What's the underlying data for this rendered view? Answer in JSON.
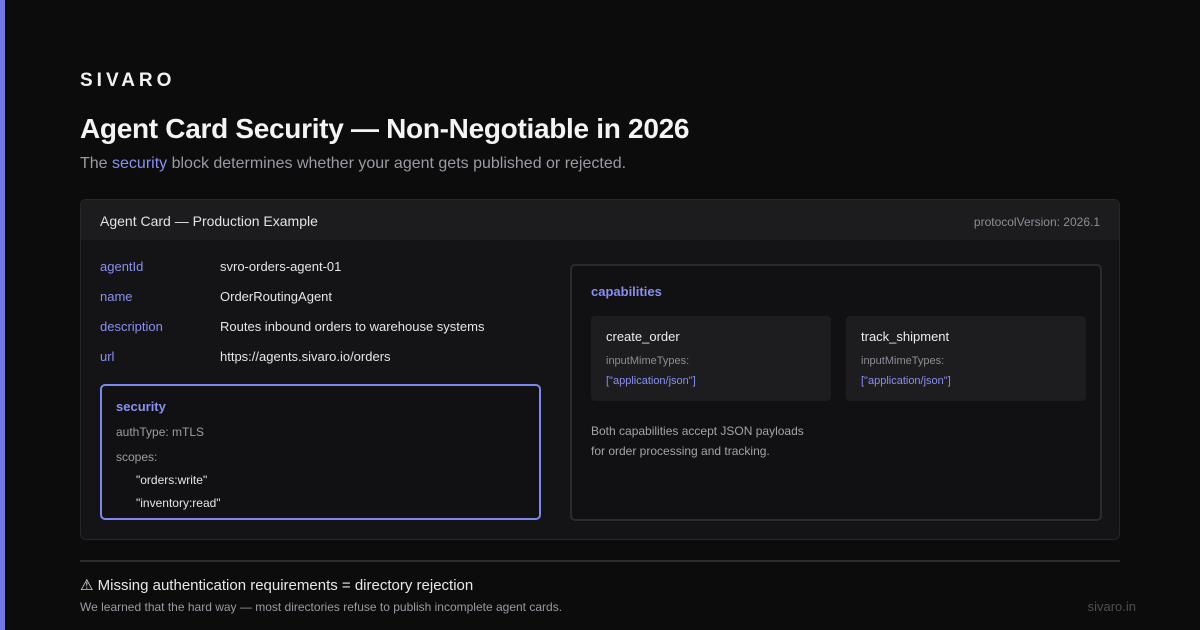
{
  "brand": "SIVARO",
  "title": "Agent Card Security — Non-Negotiable in 2026",
  "subtitle": {
    "before": "The ",
    "highlight": "security",
    "after": " block determines whether your agent gets published or rejected."
  },
  "card": {
    "title": "Agent Card — Production Example",
    "protocol": "protocolVersion: 2026.1",
    "fields": [
      {
        "key": "agentId",
        "value": "svro-orders-agent-01"
      },
      {
        "key": "name",
        "value": "OrderRoutingAgent"
      },
      {
        "key": "description",
        "value": "Routes inbound orders to warehouse systems"
      },
      {
        "key": "url",
        "value": "https://agents.sivaro.io/orders"
      }
    ],
    "security": {
      "title": "security",
      "auth": "authType: mTLS",
      "scopes_label": "scopes:",
      "scopes": [
        "\"orders:write\"",
        "\"inventory:read\""
      ]
    },
    "capabilities": {
      "title": "capabilities",
      "items": [
        {
          "name": "create_order",
          "mime_label": "inputMimeTypes:",
          "mime_value": "[\"application/json\"]"
        },
        {
          "name": "track_shipment",
          "mime_label": "inputMimeTypes:",
          "mime_value": "[\"application/json\"]"
        }
      ],
      "note": [
        "Both capabilities accept JSON payloads",
        "for order processing and tracking."
      ]
    }
  },
  "warning": {
    "text": "⚠ Missing authentication requirements = directory rejection",
    "sub": "We learned that the hard way — most directories refuse to publish incomplete agent cards."
  },
  "footer_url": "sivaro.in",
  "colors": {
    "accent": "#7f86ec",
    "background": "#0c0c0d",
    "card": "#141416"
  }
}
